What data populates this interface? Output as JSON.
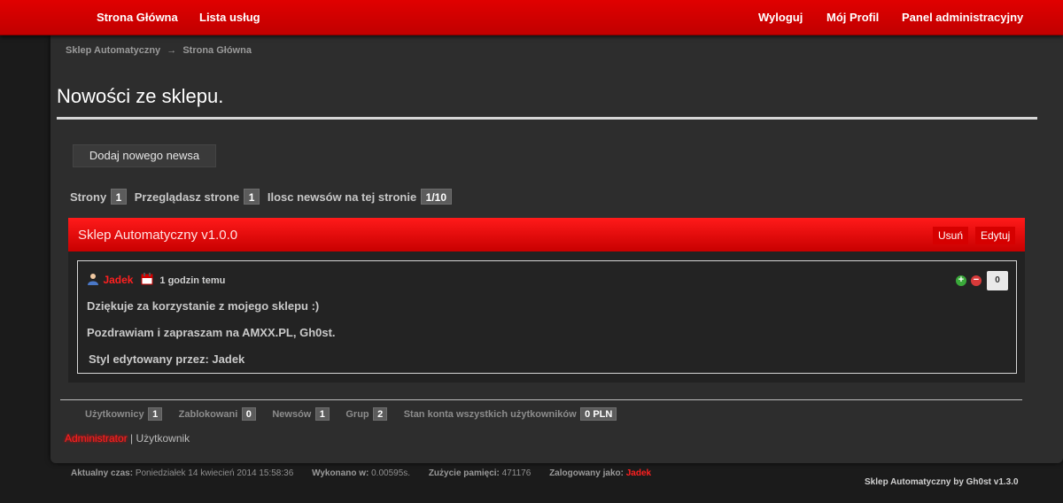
{
  "nav": {
    "home": "Strona Główna",
    "services": "Lista usług",
    "logout": "Wyloguj",
    "profile": "Mój Profil",
    "admin_panel": "Panel administracyjny"
  },
  "breadcrumb": {
    "root": "Sklep Automatyczny",
    "arrow": "→",
    "current": "Strona Główna"
  },
  "page_title": "Nowości ze sklepu.",
  "add_news_button": "Dodaj nowego newsa",
  "pagination": {
    "pages_label": "Strony",
    "pages_value": "1",
    "viewing_label": "Przeglądasz strone",
    "viewing_value": "1",
    "count_label": "Ilosc newsów na tej stronie",
    "count_value": "1/10"
  },
  "news": {
    "title": "Sklep Automatyczny v1.0.0",
    "delete_label": "Usuń",
    "edit_label": "Edytuj",
    "author": "Jadek",
    "time": "1 godzin temu",
    "votes": "0",
    "lines": [
      "Dziękuje za korzystanie z mojego sklepu :)",
      "Pozdrawiam i zapraszam na AMXX.PL, Gh0st.",
      "Styl edytowany przez: Jadek"
    ]
  },
  "stats": {
    "users_label": "Użytkownicy",
    "users_value": "1",
    "blocked_label": "Zablokowani",
    "blocked_value": "0",
    "news_label": "Newsów",
    "news_value": "1",
    "groups_label": "Grup",
    "groups_value": "2",
    "balance_label": "Stan konta wszystkich użytkowników",
    "balance_value": "0 PLN"
  },
  "roles": {
    "admin": "Administrator",
    "separator": "|",
    "user": "Użytkownik"
  },
  "footer": {
    "time_label": "Aktualny czas:",
    "time_value": "Poniedziałek 14 kwiecień 2014 15:58:36",
    "exec_label": "Wykonano w:",
    "exec_value": "0.00595s.",
    "memory_label": "Zużycie pamięci:",
    "memory_value": "471176",
    "logged_label": "Zalogowany jako:",
    "logged_value": "Jadek",
    "credit": "Sklep Automatyczny by Gh0st v1.3.0"
  },
  "colors": {
    "accent_red": "#e00000",
    "panel_bg": "#2d2d2d",
    "page_bg": "#1b1b1b"
  }
}
